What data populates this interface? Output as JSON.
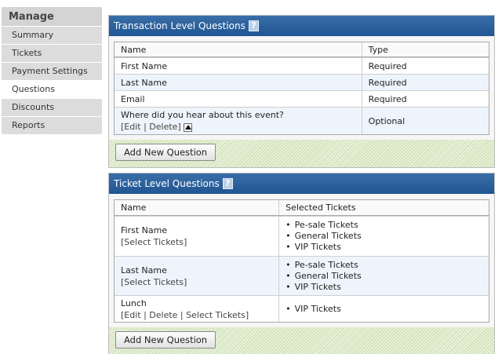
{
  "sidebar": {
    "title": "Manage",
    "items": [
      {
        "label": "Summary",
        "active": false
      },
      {
        "label": "Tickets",
        "active": false
      },
      {
        "label": "Payment Settings",
        "active": false
      },
      {
        "label": "Questions",
        "active": true
      },
      {
        "label": "Discounts",
        "active": false
      },
      {
        "label": "Reports",
        "active": false
      }
    ]
  },
  "transaction": {
    "title": "Transaction Level Questions",
    "help_icon": "?",
    "headers": {
      "name": "Name",
      "type": "Type"
    },
    "rows": [
      {
        "name": "First Name",
        "type": "Required"
      },
      {
        "name": "Last Name",
        "type": "Required"
      },
      {
        "name": "Email",
        "type": "Required"
      },
      {
        "name": "Where did you hear about this event?",
        "actions": "[Edit | Delete]",
        "type": "Optional"
      }
    ],
    "button": "Add New Question"
  },
  "ticket": {
    "title": "Ticket Level Questions",
    "help_icon": "?",
    "headers": {
      "name": "Name",
      "tickets": "Selected Tickets"
    },
    "rows": [
      {
        "name": "First Name",
        "actions": "[Select Tickets]",
        "tickets": [
          "Pe-sale Tickets",
          "General Tickets",
          "VIP Tickets"
        ]
      },
      {
        "name": "Last Name",
        "actions": "[Select Tickets]",
        "tickets": [
          "Pe-sale Tickets",
          "General Tickets",
          "VIP Tickets"
        ]
      },
      {
        "name": "Lunch",
        "actions": "[Edit | Delete | Select Tickets]",
        "tickets": [
          "VIP Tickets"
        ]
      }
    ],
    "button": "Add New Question"
  },
  "colors": {
    "header_blue": "#2a609e",
    "footer_green": "#c6dca9",
    "row_alt": "#eef4fb"
  }
}
